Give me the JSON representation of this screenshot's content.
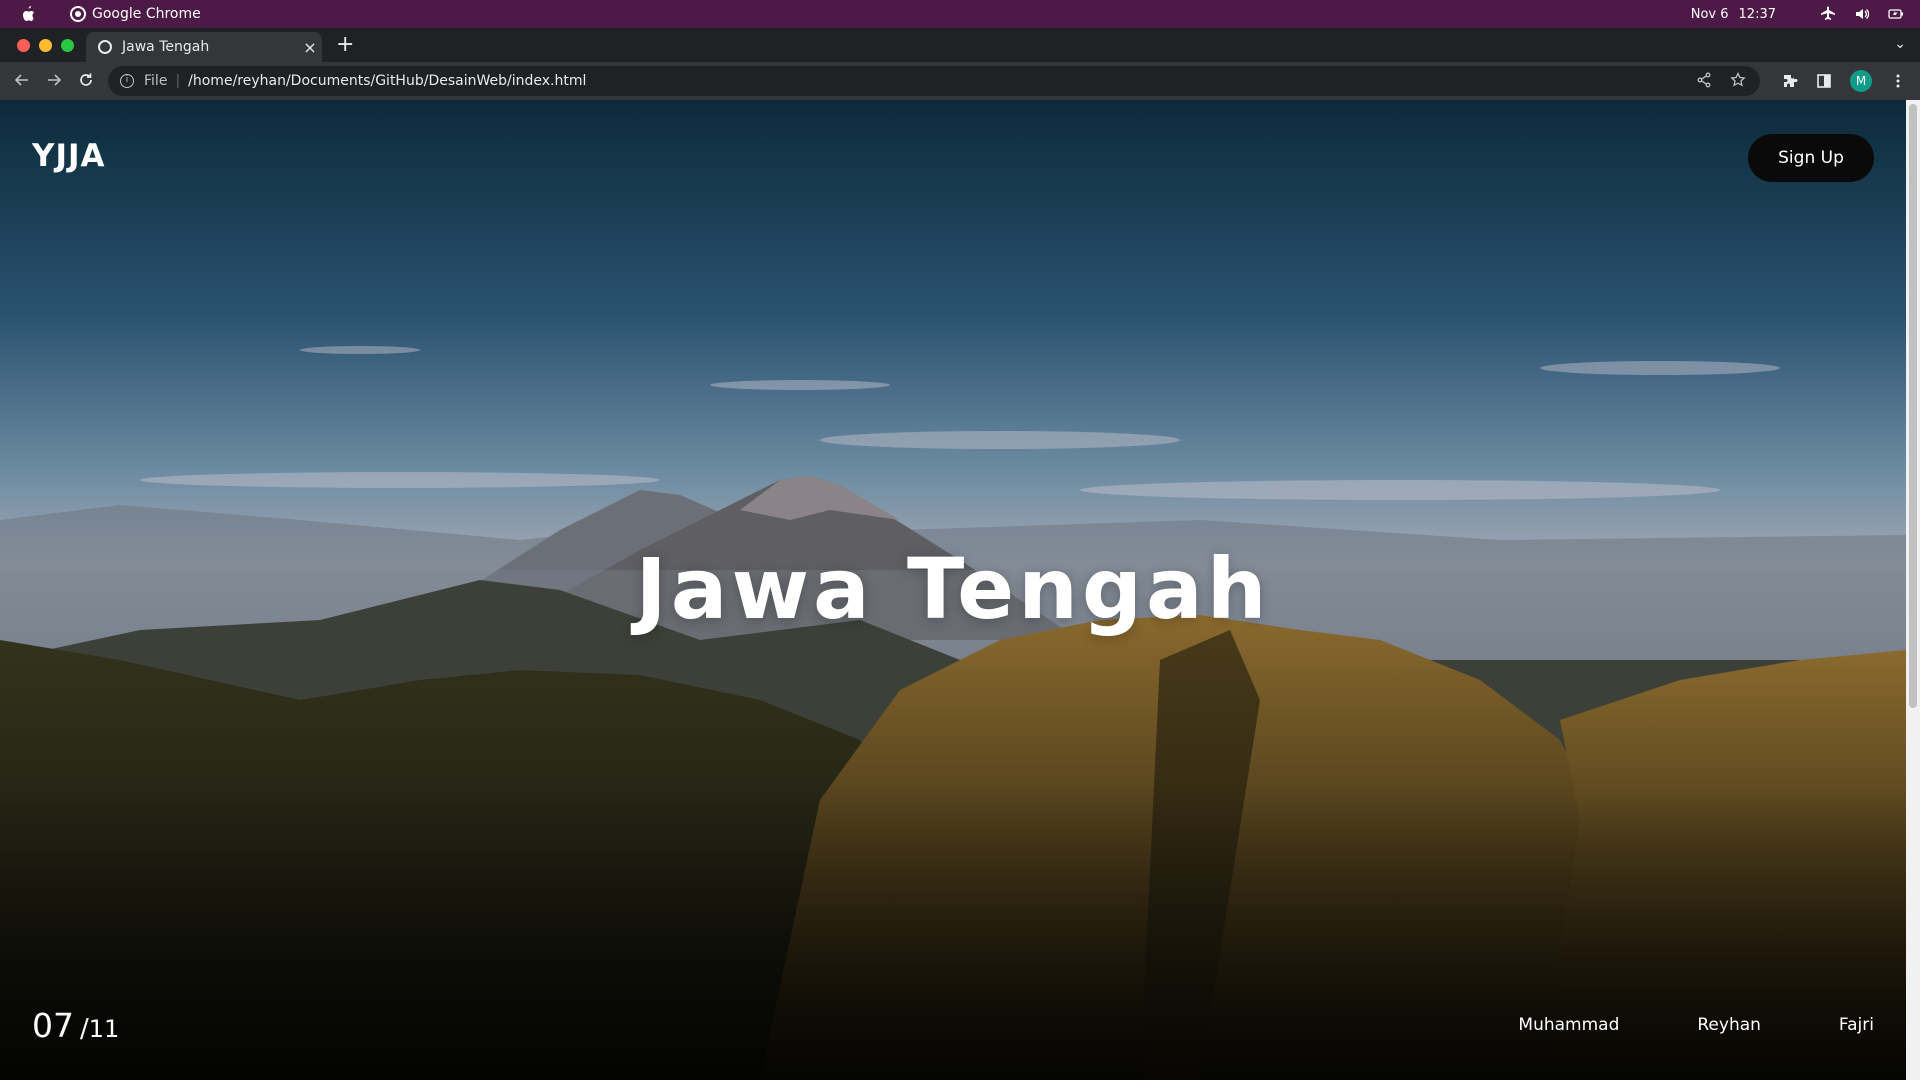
{
  "os": {
    "app_name": "Google Chrome",
    "date": "Nov 6",
    "time": "12:37"
  },
  "browser": {
    "tab_title": "Jawa Tengah",
    "tab_close": "×",
    "new_tab": "+",
    "tab_search": "⌄",
    "scheme": "File",
    "url": "/home/reyhan/Documents/GitHub/DesainWeb/index.html",
    "profile_initial": "M"
  },
  "page": {
    "logo": "YJJA",
    "signup_label": "Sign Up",
    "hero_title": "Jawa Tengah",
    "slide_current": "07",
    "slide_separator": "/",
    "slide_total": "11",
    "credits": [
      "Muhammad",
      "Reyhan",
      "Fajri"
    ]
  },
  "colors": {
    "os_bar": "#4d1a47",
    "tab_strip": "#202124",
    "toolbar": "#35363a",
    "signup_bg": "#0a0a0a",
    "profile_bg": "#0f9d8a"
  }
}
